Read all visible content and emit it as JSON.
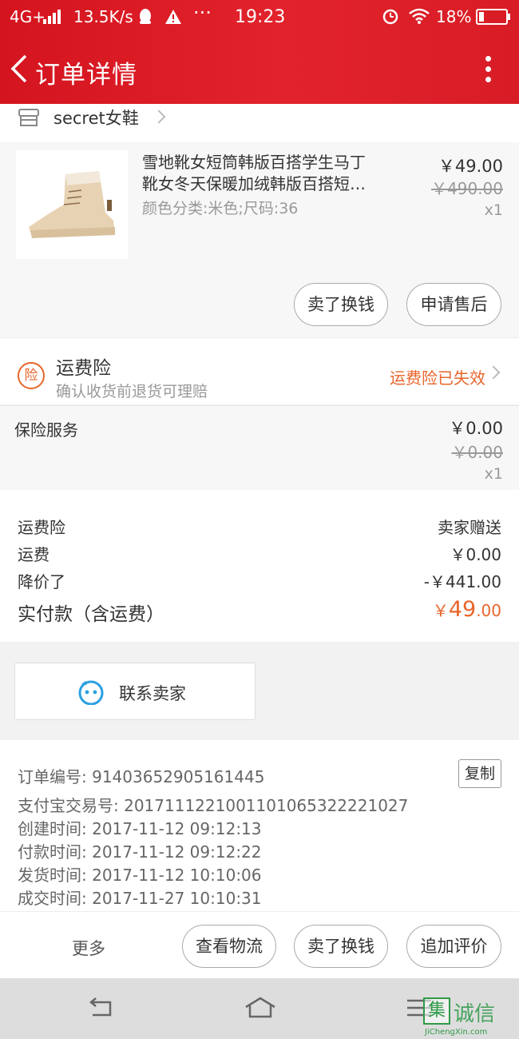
{
  "status_bar": {
    "network": "4G+",
    "speed": "13.5K/s",
    "time": "19:23",
    "battery": "18%",
    "icons": [
      "signal-icon",
      "qq-icon",
      "warning-icon",
      "more-dots-icon",
      "alarm-icon",
      "wifi-icon",
      "battery-icon"
    ]
  },
  "header": {
    "title": "订单详情"
  },
  "shop": {
    "name": "secret女鞋"
  },
  "product": {
    "title_line1": "雪地靴女短筒韩版百搭学生马丁",
    "title_line2": "靴女冬天保暖加绒韩版百搭短…",
    "sku": "颜色分类:米色;尺码:36",
    "price": "￥49.00",
    "original_price": "￥490.00",
    "quantity": "x1",
    "actions": [
      "卖了换钱",
      "申请售后"
    ]
  },
  "insurance": {
    "badge": "险",
    "title": "运费险",
    "subtitle": "确认收货前退货可理赔",
    "status": "运费险已失效"
  },
  "service": {
    "label": "保险服务",
    "price": "￥0.00",
    "original_price": "￥0.00",
    "quantity": "x1"
  },
  "summary": {
    "rows": [
      {
        "label": "运费险",
        "value": "卖家赠送"
      },
      {
        "label": "运费",
        "value": "￥0.00"
      },
      {
        "label": "降价了",
        "value": "-￥441.00"
      }
    ],
    "total_label": "实付款（含运费）",
    "total_symbol": "￥",
    "total_int": "49",
    "total_dec": ".00"
  },
  "contact": {
    "label": "联系卖家"
  },
  "order_info": {
    "copy_label": "复制",
    "lines": [
      "订单编号: 91403652905161445",
      "支付宝交易号: 2017111221001101065322221027",
      "创建时间: 2017-11-12 09:12:13",
      "付款时间: 2017-11-12 09:12:22",
      "发货时间: 2017-11-12 10:10:06",
      "成交时间: 2017-11-27 10:10:31"
    ]
  },
  "bottom_actions": {
    "more": "更多",
    "buttons": [
      "查看物流",
      "卖了换钱",
      "追加评价"
    ]
  },
  "watermark": {
    "char": "集",
    "text": "诚信",
    "url": "JiChengXin.com"
  },
  "colors": {
    "header_red": "#d81c25",
    "accent_orange": "#e8652a",
    "contact_blue": "#2aa0e0"
  }
}
